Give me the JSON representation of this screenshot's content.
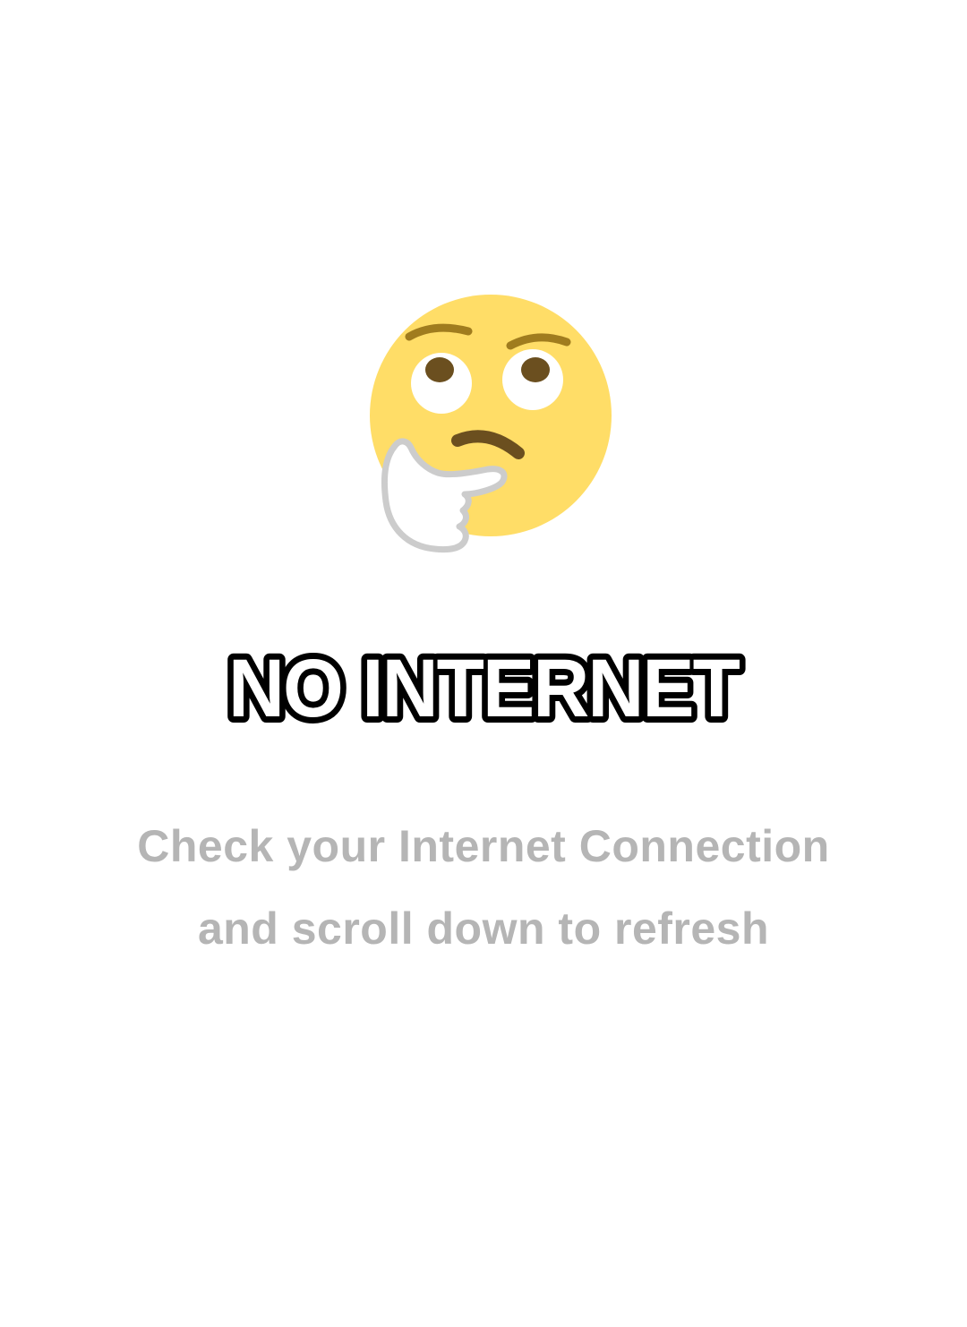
{
  "error_screen": {
    "icon": "thinking-face-emoji",
    "title": "NO INTERNET",
    "message_line1": "Check your Internet Connection",
    "message_line2": "and scroll down to refresh"
  },
  "colors": {
    "background": "#ffffff",
    "emoji_face": "#FFDD67",
    "emoji_features": "#6B4F1F",
    "emoji_brows": "#8B6A1A",
    "hand_fill": "#ffffff",
    "hand_outline": "#cfcfcf",
    "title_fill": "#ffffff",
    "title_stroke": "#000000",
    "message_text": "#b5b5b5"
  }
}
